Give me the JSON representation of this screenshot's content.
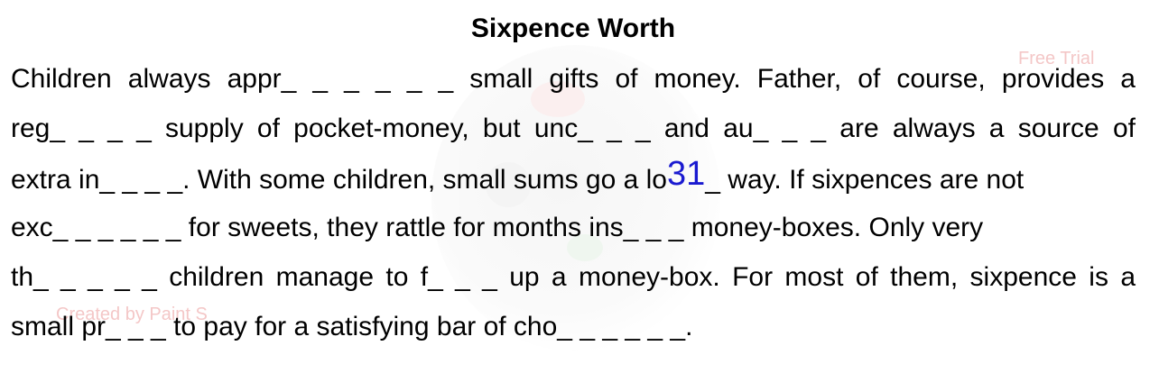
{
  "title": "Sixpence Worth",
  "watermarks": {
    "top_right": "Free Trial",
    "bottom_left": "Created by Paint S"
  },
  "page_number": "31",
  "colors": {
    "page_number": "#1a1ad0",
    "watermark_text": "#f4c7c7"
  },
  "lines": [
    "Children always appr_ _ _ _ _ _ small gifts of money. Father, of course, provides a",
    "reg_ _ _ _ supply of pocket-money, but unc_ _ _ and au_ _ _ are always a source of",
    {
      "before": "extra in_ _ _ _. With some children, small sums go a lo",
      "after": "_ way. If sixpences are not"
    },
    "exc_ _ _ _ _ _ for sweets, they rattle for months ins_ _ _ money-boxes. Only very",
    "th_ _ _ _ _ children manage to f_ _ _ up a money-box. For most of them, sixpence is a",
    "small pr_ _ _ to pay for a satisfying bar of cho_ _ _ _ _ _."
  ]
}
